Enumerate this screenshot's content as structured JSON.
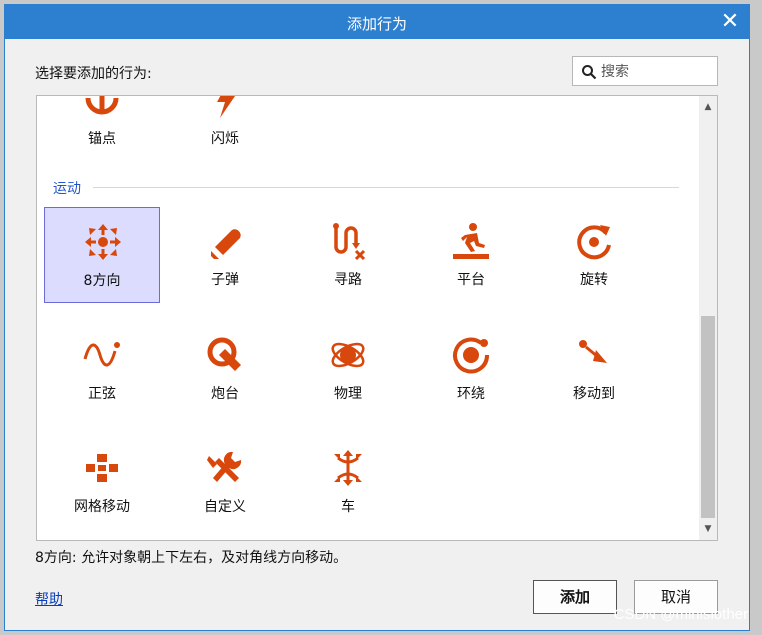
{
  "dialog": {
    "title": "添加行为",
    "close_glyph": "✕",
    "prompt": "选择要添加的行为:",
    "search_placeholder": "搜索",
    "description": "8方向: 允许对象朝上下左右，及对角线方向移动。",
    "help_label": "帮助",
    "add_label": "添加",
    "cancel_label": "取消"
  },
  "behaviors": {
    "top_partial": [
      {
        "label": "锚点",
        "icon": "anchor-icon"
      },
      {
        "label": "闪烁",
        "icon": "flash-icon"
      }
    ],
    "section_title": "运动",
    "movement": [
      {
        "label": "8方向",
        "icon": "eight-direction-icon",
        "selected": true
      },
      {
        "label": "子弹",
        "icon": "bullet-icon"
      },
      {
        "label": "寻路",
        "icon": "pathfinding-icon"
      },
      {
        "label": "平台",
        "icon": "platform-icon"
      },
      {
        "label": "旋转",
        "icon": "rotate-icon"
      },
      {
        "label": "正弦",
        "icon": "sine-icon"
      },
      {
        "label": "炮台",
        "icon": "turret-icon"
      },
      {
        "label": "物理",
        "icon": "physics-icon"
      },
      {
        "label": "环绕",
        "icon": "orbit-icon"
      },
      {
        "label": "移动到",
        "icon": "move-to-icon"
      },
      {
        "label": "网格移动",
        "icon": "tile-movement-icon"
      },
      {
        "label": "自定义",
        "icon": "custom-icon"
      },
      {
        "label": "车",
        "icon": "car-icon"
      }
    ]
  },
  "colors": {
    "accent": "#2d7fd0",
    "icon": "#d8470b",
    "selection": "#dcdcff"
  },
  "watermark": "CSDN @minislother"
}
